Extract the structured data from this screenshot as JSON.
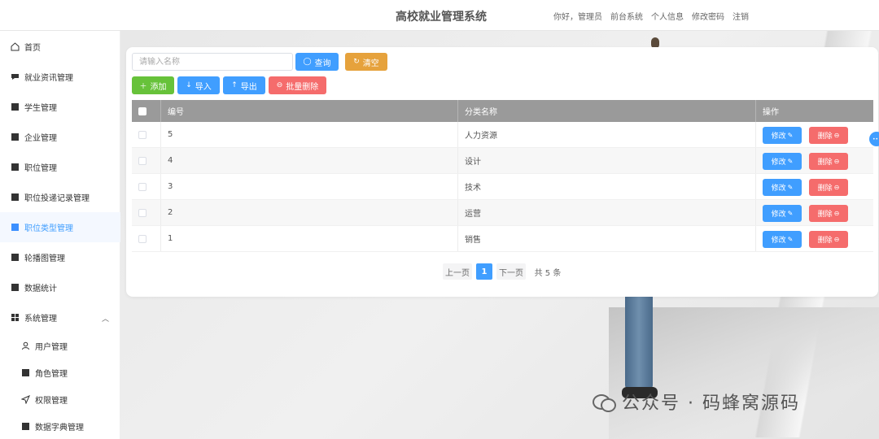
{
  "header": {
    "title": "高校就业管理系统",
    "links": [
      "你好，管理员",
      "前台系统",
      "个人信息",
      "修改密码",
      "注销"
    ]
  },
  "sidebar": {
    "items": [
      {
        "label": "首页",
        "icon": "home-icon"
      },
      {
        "label": "就业资讯管理",
        "icon": "chat-icon"
      },
      {
        "label": "学生管理",
        "icon": "grid-icon"
      },
      {
        "label": "企业管理",
        "icon": "grid-icon"
      },
      {
        "label": "职位管理",
        "icon": "grid-icon"
      },
      {
        "label": "职位投递记录管理",
        "icon": "grid-icon"
      },
      {
        "label": "职位类型管理",
        "icon": "grid-icon",
        "active": true
      },
      {
        "label": "轮播图管理",
        "icon": "grid-icon"
      },
      {
        "label": "数据统计",
        "icon": "grid-icon"
      },
      {
        "label": "系统管理",
        "icon": "apps-icon",
        "expanded": true
      },
      {
        "label": "用户管理",
        "icon": "user-icon"
      },
      {
        "label": "角色管理",
        "icon": "grid-icon"
      },
      {
        "label": "权限管理",
        "icon": "send-icon"
      },
      {
        "label": "数据字典管理",
        "icon": "grid-icon"
      }
    ]
  },
  "search": {
    "placeholder": "请输入名称",
    "query_label": "查询",
    "clear_label": "清空"
  },
  "toolbar": {
    "add_label": "添加",
    "import_label": "导入",
    "export_label": "导出",
    "batch_delete_label": "批量删除"
  },
  "table": {
    "columns": [
      "编号",
      "分类名称",
      "操作"
    ],
    "rows": [
      {
        "id": "5",
        "name": "人力资源"
      },
      {
        "id": "4",
        "name": "设计"
      },
      {
        "id": "3",
        "name": "技术"
      },
      {
        "id": "2",
        "name": "运营"
      },
      {
        "id": "1",
        "name": "销售"
      }
    ],
    "edit_label": "修改",
    "delete_label": "删除"
  },
  "pagination": {
    "prev_label": "上一页",
    "current_page": "1",
    "next_label": "下一页",
    "total_label": "共 5 条"
  },
  "watermark": "公众号 · 码蜂窝源码",
  "colors": {
    "primary": "#409eff",
    "success": "#67c23a",
    "warning": "#e6a23c",
    "danger": "#f56c6c",
    "table_header": "#9a9a9a"
  }
}
